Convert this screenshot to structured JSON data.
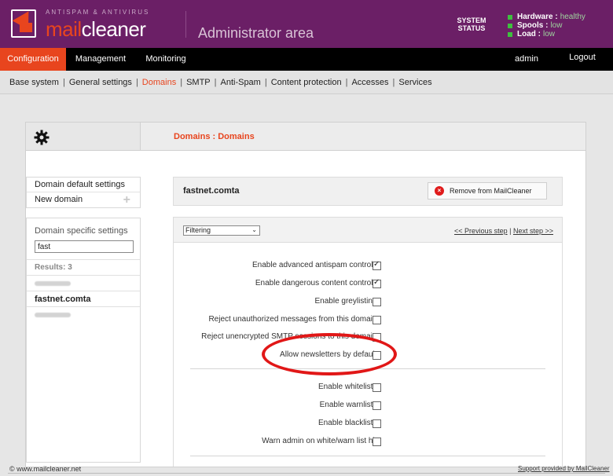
{
  "header": {
    "brand_sub": "ANTISPAM & ANTIVIRUS",
    "brand_main_prefix": "mail",
    "brand_main_suffix": "cleaner",
    "area": "Administrator area",
    "system_status": "SYSTEM STATUS",
    "status": [
      {
        "key": "Hardware :",
        "value": "healthy"
      },
      {
        "key": "Spools :",
        "value": "low"
      },
      {
        "key": "Load :",
        "value": "low"
      }
    ]
  },
  "mainnav": {
    "configuration": "Configuration",
    "management": "Management",
    "monitoring": "Monitoring",
    "user": "admin",
    "logout": "Logout"
  },
  "subnav": {
    "items": [
      "Base system",
      "General settings",
      "Domains",
      "SMTP",
      "Anti-Spam",
      "Content protection",
      "Accesses",
      "Services"
    ],
    "active": "Domains"
  },
  "page": {
    "title": "Domains : Domains"
  },
  "sidebar": {
    "default_settings": "Domain default settings",
    "new_domain": "New domain",
    "plus": "+",
    "specific_title": "Domain specific settings",
    "search_value": "fast",
    "results": "Results: 3",
    "selected_domain": "fastnet.comta"
  },
  "domain": {
    "name": "fastnet.comta",
    "remove_label": "Remove from MailCleaner",
    "remove_icon": "×"
  },
  "settings": {
    "filter_value": "Filtering",
    "prev_step": "<< Previous step",
    "step_sep": "|",
    "next_step": "Next step >>",
    "options": [
      {
        "label": "Enable advanced antispam controls :",
        "checked": true
      },
      {
        "label": "Enable dangerous content controls :",
        "checked": true
      },
      {
        "label": "Enable greylisting :",
        "checked": false
      },
      {
        "label": "Reject unauthorized messages from this domain :",
        "checked": false
      },
      {
        "label": "Reject unencrypted SMTP sessions to this domain :",
        "checked": false
      },
      {
        "label": "Allow newsletters by default :",
        "checked": false
      },
      {
        "label": "Enable whitelists :",
        "checked": false
      },
      {
        "label": "Enable warnlists :",
        "checked": false
      },
      {
        "label": "Enable blacklists :",
        "checked": false
      },
      {
        "label": "Warn admin on white/warn list hit :",
        "checked": false
      }
    ]
  },
  "footer": {
    "left": "© www.mailcleaner.net",
    "right": "Support provided by MailCleaner"
  },
  "colors": {
    "brand_purple": "#6b1f66",
    "accent_orange": "#e8451e",
    "highlight_red": "#e11717"
  }
}
